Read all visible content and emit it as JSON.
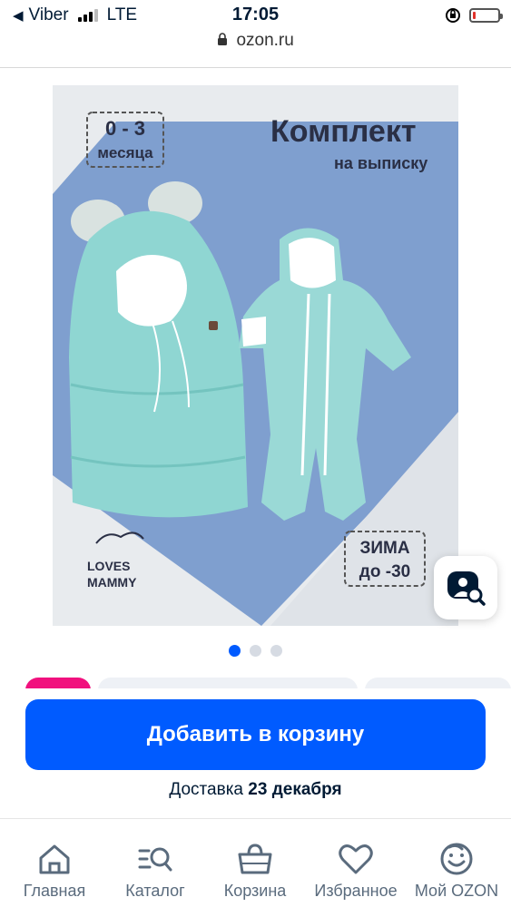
{
  "status_bar": {
    "back_app": "Viber",
    "network": "LTE",
    "time": "17:05",
    "battery_level": 0.1
  },
  "url_bar": {
    "domain": "ozon.ru"
  },
  "product_image": {
    "age_badge_line1": "0 - 3",
    "age_badge_line2": "месяца",
    "title": "Комплект",
    "subtitle": "на выписку",
    "brand_line1": "LOVES",
    "brand_line2": "MAMMY",
    "season_line1": "ЗИМА",
    "season_line2": "до -30"
  },
  "gallery": {
    "total": 3,
    "active": 1
  },
  "add_to_cart": {
    "label": "Добавить в корзину"
  },
  "delivery": {
    "prefix": "Доставка",
    "date": "23 декабря"
  },
  "tabbar": {
    "items": [
      {
        "label": "Главная",
        "icon": "home-icon"
      },
      {
        "label": "Каталог",
        "icon": "catalog-search-icon"
      },
      {
        "label": "Корзина",
        "icon": "basket-icon"
      },
      {
        "label": "Избранное",
        "icon": "heart-icon"
      },
      {
        "label": "Мой OZON",
        "icon": "smiley-icon"
      }
    ]
  },
  "colors": {
    "accent": "#005bff",
    "text": "#001a34",
    "product": "#8fd6d2",
    "backdrop": "#7f9fcf"
  }
}
